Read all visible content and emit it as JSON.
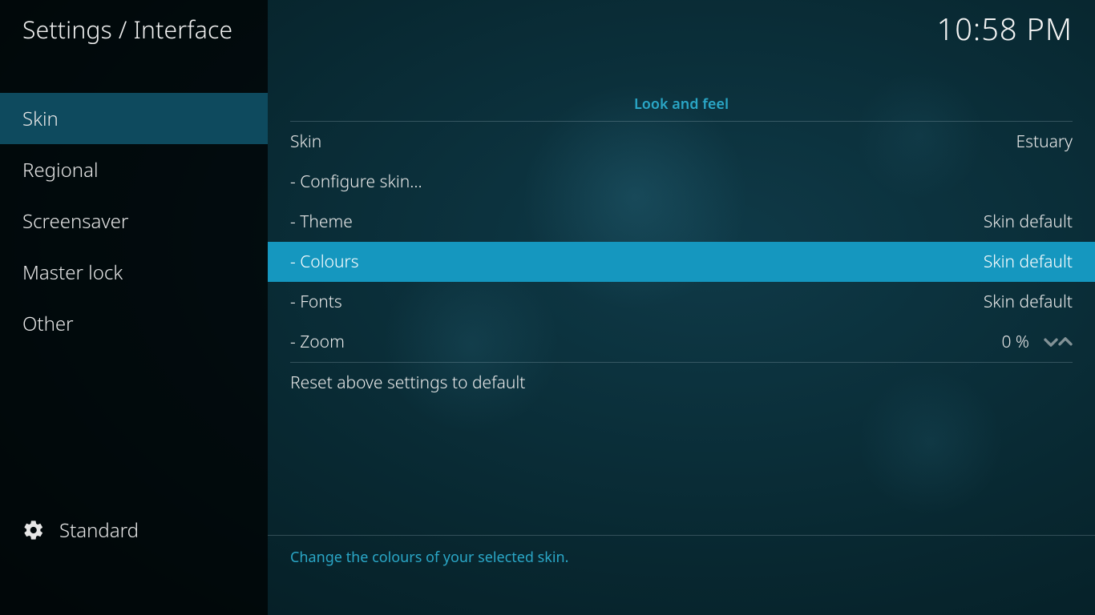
{
  "header": {
    "breadcrumb": "Settings / Interface",
    "clock": "10:58 PM"
  },
  "sidebar": {
    "items": [
      {
        "label": "Skin",
        "selected": true
      },
      {
        "label": "Regional",
        "selected": false
      },
      {
        "label": "Screensaver",
        "selected": false
      },
      {
        "label": "Master lock",
        "selected": false
      },
      {
        "label": "Other",
        "selected": false
      }
    ],
    "level_label": "Standard"
  },
  "main": {
    "section_title": "Look and feel",
    "settings": [
      {
        "label": "Skin",
        "value": "Estuary",
        "type": "select",
        "indent": false
      },
      {
        "label": "- Configure skin...",
        "value": "",
        "type": "action",
        "indent": true
      },
      {
        "label": "- Theme",
        "value": "Skin default",
        "type": "select",
        "indent": true
      },
      {
        "label": "- Colours",
        "value": "Skin default",
        "type": "select",
        "indent": true,
        "highlight": true
      },
      {
        "label": "- Fonts",
        "value": "Skin default",
        "type": "select",
        "indent": true
      },
      {
        "label": "- Zoom",
        "value": "0 %",
        "type": "spinner",
        "indent": true
      }
    ],
    "reset_label": "Reset above settings to default",
    "help_text": "Change the colours of your selected skin."
  }
}
